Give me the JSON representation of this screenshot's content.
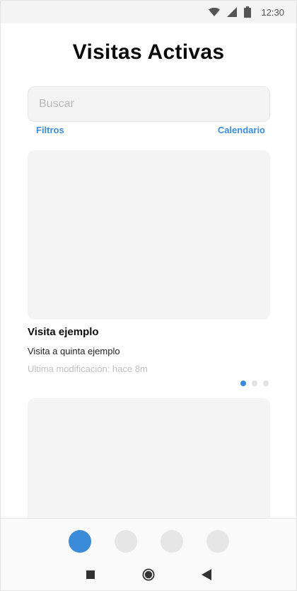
{
  "status_bar": {
    "time": "12:30",
    "icons": [
      "wifi-icon",
      "signal-icon",
      "battery-icon"
    ]
  },
  "page": {
    "title": "Visitas Activas"
  },
  "search": {
    "placeholder": "Buscar",
    "value": ""
  },
  "links": {
    "filters_label": "Filtros",
    "calendar_label": "Calendario"
  },
  "cards": [
    {
      "title": "Visita ejemplo",
      "description": "Visita a quinta ejemplo",
      "meta": "Ultima modificación: hace 8m",
      "carousel": {
        "count": 3,
        "active_index": 0
      }
    },
    {
      "title": "",
      "description": "",
      "meta": ""
    }
  ],
  "bottom_nav": {
    "tabs": [
      {
        "name": "tab-1",
        "active": true
      },
      {
        "name": "tab-2",
        "active": false
      },
      {
        "name": "tab-3",
        "active": false
      },
      {
        "name": "tab-4",
        "active": false
      }
    ]
  },
  "system_nav": {
    "buttons": [
      "recents-icon",
      "home-icon",
      "back-icon"
    ]
  },
  "colors": {
    "accent": "#3a8bd9",
    "placeholder_bg": "#f4f4f4",
    "muted_text": "#c0c0c0"
  }
}
